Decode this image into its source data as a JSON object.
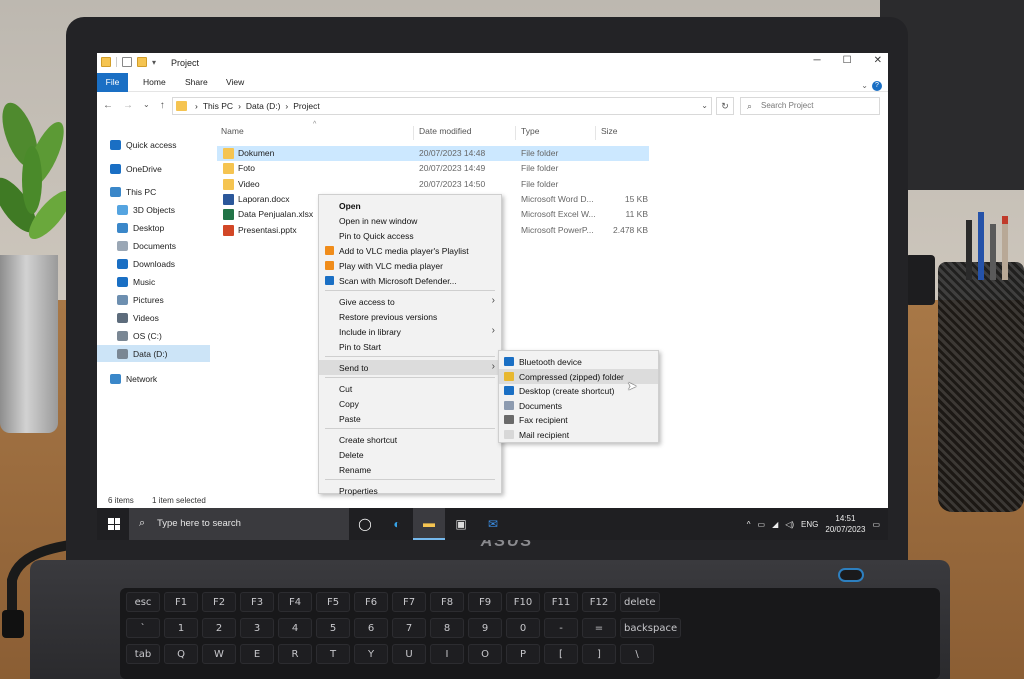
{
  "window": {
    "title": "Project",
    "controls": {
      "minimize": "─",
      "maximize": "☐",
      "close": "✕"
    }
  },
  "ribbon": {
    "tabs": [
      "File",
      "Home",
      "Share",
      "View"
    ],
    "help": "?",
    "expand": "⌄"
  },
  "address": {
    "nav": {
      "back": "←",
      "forward": "→",
      "recent": "⌄",
      "up": "↑"
    },
    "crumbs": [
      "›",
      "This PC",
      "›",
      "Data (D:)",
      "›",
      "Project"
    ],
    "dropdown": "⌄",
    "refresh": "↻",
    "search_placeholder": "Search Project",
    "search_icon": "⌕"
  },
  "navpane": {
    "items": [
      {
        "label": "Quick access",
        "icon": "star-icon",
        "color": "#1a6fc4"
      },
      {
        "label": "OneDrive",
        "icon": "cloud-icon",
        "color": "#1a6fc4"
      },
      {
        "label": "This PC",
        "icon": "computer-icon",
        "color": "#3a87c9"
      },
      {
        "label": "3D Objects",
        "icon": "cube-icon",
        "color": "#55a4e0"
      },
      {
        "label": "Desktop",
        "icon": "desktop-icon",
        "color": "#3a87c9"
      },
      {
        "label": "Documents",
        "icon": "document-icon",
        "color": "#9aa7b5"
      },
      {
        "label": "Downloads",
        "icon": "download-icon",
        "color": "#1a6fc4"
      },
      {
        "label": "Music",
        "icon": "music-icon",
        "color": "#1a6fc4"
      },
      {
        "label": "Pictures",
        "icon": "picture-icon",
        "color": "#6d8fb0"
      },
      {
        "label": "Videos",
        "icon": "video-icon",
        "color": "#5d6c7c"
      },
      {
        "label": "OS (C:)",
        "icon": "drive-icon",
        "color": "#7a8794"
      },
      {
        "label": "Data (D:)",
        "icon": "drive-icon",
        "color": "#7a8794"
      },
      {
        "label": "Network",
        "icon": "network-icon",
        "color": "#3a87c9"
      }
    ]
  },
  "filelist": {
    "headers": {
      "name": "Name",
      "date": "Date modified",
      "type": "Type",
      "size": "Size"
    },
    "sort_indicator": "^",
    "rows": [
      {
        "name": "Dokumen",
        "date": "20/07/2023 14:48",
        "type": "File folder",
        "size": "",
        "icon": "folder-icon",
        "color": "#f5c451"
      },
      {
        "name": "Foto",
        "date": "20/07/2023 14:49",
        "type": "File folder",
        "size": "",
        "icon": "folder-icon",
        "color": "#f5c451"
      },
      {
        "name": "Video",
        "date": "20/07/2023 14:50",
        "type": "File folder",
        "size": "",
        "icon": "folder-icon",
        "color": "#f5c451"
      },
      {
        "name": "Laporan.docx",
        "date": "",
        "type": "Microsoft Word D...",
        "size": "15 KB",
        "icon": "word-icon",
        "color": "#2b579a"
      },
      {
        "name": "Data Penjualan.xlsx",
        "date": "",
        "type": "Microsoft Excel W...",
        "size": "11 KB",
        "icon": "excel-icon",
        "color": "#217346"
      },
      {
        "name": "Presentasi.pptx",
        "date": "",
        "type": "Microsoft PowerP...",
        "size": "2.478 KB",
        "icon": "powerpoint-icon",
        "color": "#d24726"
      }
    ]
  },
  "context_menu": {
    "items": [
      {
        "label": "Open",
        "bold": true
      },
      {
        "label": "Open in new window"
      },
      {
        "label": "Pin to Quick access"
      },
      {
        "label": "Add to VLC media player's Playlist",
        "icon": "vlc-icon",
        "color": "#f08c1a"
      },
      {
        "label": "Play with VLC media player",
        "icon": "vlc-icon",
        "color": "#f08c1a"
      },
      {
        "label": "Scan with Microsoft Defender...",
        "icon": "defender-icon",
        "color": "#1a6fc4"
      },
      {
        "sep": true
      },
      {
        "label": "Give access to",
        "submenu": true
      },
      {
        "label": "Restore previous versions"
      },
      {
        "label": "Include in library",
        "submenu": true
      },
      {
        "label": "Pin to Start"
      },
      {
        "sep": true
      },
      {
        "label": "Send to",
        "submenu": true,
        "hover": true
      },
      {
        "sep": true
      },
      {
        "label": "Cut"
      },
      {
        "label": "Copy"
      },
      {
        "label": "Paste"
      },
      {
        "sep": true
      },
      {
        "label": "Create shortcut"
      },
      {
        "label": "Delete"
      },
      {
        "label": "Rename"
      },
      {
        "sep": true
      },
      {
        "label": "Properties"
      }
    ],
    "arrow": "›"
  },
  "send_to": {
    "items": [
      {
        "label": "Bluetooth device",
        "icon": "bluetooth-icon",
        "color": "#1a6fc4"
      },
      {
        "label": "Compressed (zipped) folder",
        "icon": "zip-folder-icon",
        "color": "#e8b830",
        "hover": true
      },
      {
        "label": "Desktop (create shortcut)",
        "icon": "desktop-icon",
        "color": "#1a6fc4"
      },
      {
        "label": "Documents",
        "icon": "document-icon",
        "color": "#8d9bb0"
      },
      {
        "label": "Fax recipient",
        "icon": "fax-icon",
        "color": "#6a6a6a"
      },
      {
        "label": "Mail recipient",
        "icon": "mail-icon",
        "color": "#d8d8d8"
      }
    ]
  },
  "statusbar": {
    "count": "6 items",
    "selected": "1 item selected"
  },
  "taskbar": {
    "search_placeholder": "Type here to search",
    "apps": [
      {
        "name": "cortana",
        "glyph": "◯"
      },
      {
        "name": "edge",
        "glyph": "◐",
        "color": "#36a3e8"
      },
      {
        "name": "file-explorer",
        "glyph": "▬",
        "color": "#f5c451",
        "active": true
      },
      {
        "name": "store",
        "glyph": "▣",
        "color": "#dddddd"
      },
      {
        "name": "mail",
        "glyph": "✉",
        "color": "#3a8ee6"
      }
    ],
    "tray": {
      "chevron": "^",
      "language": "ENG",
      "time": "14:51",
      "date": "20/07/2023",
      "notification": "▭"
    }
  },
  "brand": "ASUS",
  "keyboard": {
    "rows": [
      [
        "esc",
        "F1",
        "F2",
        "F3",
        "F4",
        "F5",
        "F6",
        "F7",
        "F8",
        "F9",
        "F10",
        "F11",
        "F12",
        "delete"
      ],
      [
        "`",
        "1",
        "2",
        "3",
        "4",
        "5",
        "6",
        "7",
        "8",
        "9",
        "0",
        "-",
        "=",
        "backspace"
      ],
      [
        "tab",
        "Q",
        "W",
        "E",
        "R",
        "T",
        "Y",
        "U",
        "I",
        "O",
        "P",
        "[",
        "]",
        "\\"
      ]
    ]
  }
}
